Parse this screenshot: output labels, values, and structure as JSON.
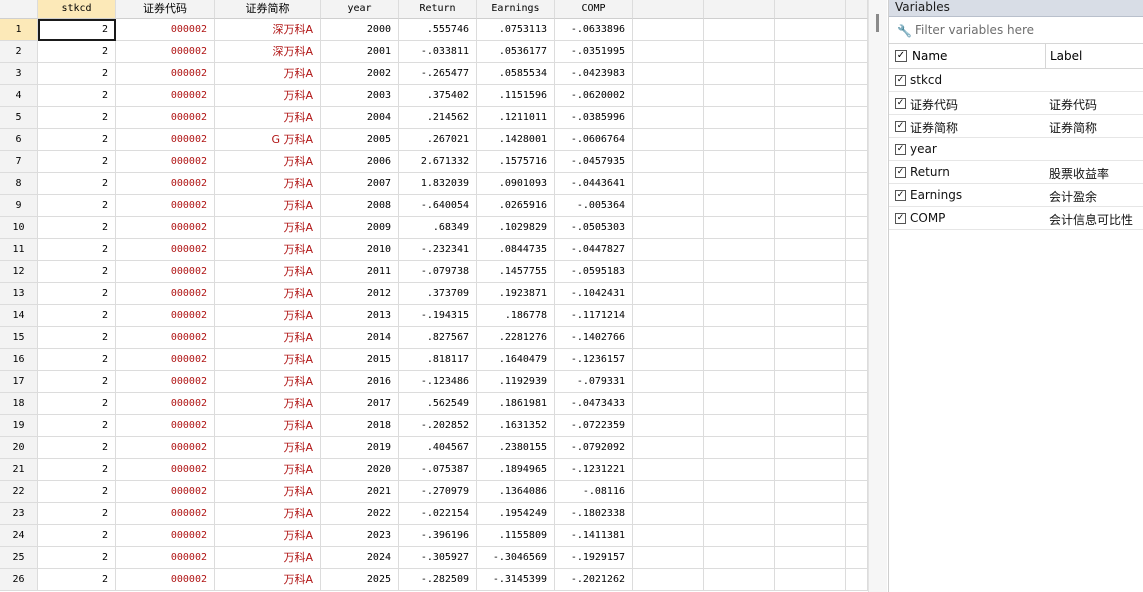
{
  "grid": {
    "headers": [
      "stkcd",
      "证券代码",
      "证券简称",
      "year",
      "Return",
      "Earnings",
      "COMP"
    ],
    "rows": [
      [
        "1",
        "2",
        "000002",
        "深万科A",
        "2000",
        ".555746",
        ".0753113",
        "-.0633896"
      ],
      [
        "2",
        "2",
        "000002",
        "深万科A",
        "2001",
        "-.033811",
        ".0536177",
        "-.0351995"
      ],
      [
        "3",
        "2",
        "000002",
        "万科A",
        "2002",
        "-.265477",
        ".0585534",
        "-.0423983"
      ],
      [
        "4",
        "2",
        "000002",
        "万科A",
        "2003",
        ".375402",
        ".1151596",
        "-.0620002"
      ],
      [
        "5",
        "2",
        "000002",
        "万科A",
        "2004",
        ".214562",
        ".1211011",
        "-.0385996"
      ],
      [
        "6",
        "2",
        "000002",
        "G 万科A",
        "2005",
        ".267021",
        ".1428001",
        "-.0606764"
      ],
      [
        "7",
        "2",
        "000002",
        "万科A",
        "2006",
        "2.671332",
        ".1575716",
        "-.0457935"
      ],
      [
        "8",
        "2",
        "000002",
        "万科A",
        "2007",
        "1.832039",
        ".0901093",
        "-.0443641"
      ],
      [
        "9",
        "2",
        "000002",
        "万科A",
        "2008",
        "-.640054",
        ".0265916",
        "-.005364"
      ],
      [
        "10",
        "2",
        "000002",
        "万科A",
        "2009",
        ".68349",
        ".1029829",
        "-.0505303"
      ],
      [
        "11",
        "2",
        "000002",
        "万科A",
        "2010",
        "-.232341",
        ".0844735",
        "-.0447827"
      ],
      [
        "12",
        "2",
        "000002",
        "万科A",
        "2011",
        "-.079738",
        ".1457755",
        "-.0595183"
      ],
      [
        "13",
        "2",
        "000002",
        "万科A",
        "2012",
        ".373709",
        ".1923871",
        "-.1042431"
      ],
      [
        "14",
        "2",
        "000002",
        "万科A",
        "2013",
        "-.194315",
        ".186778",
        "-.1171214"
      ],
      [
        "15",
        "2",
        "000002",
        "万科A",
        "2014",
        ".827567",
        ".2281276",
        "-.1402766"
      ],
      [
        "16",
        "2",
        "000002",
        "万科A",
        "2015",
        ".818117",
        ".1640479",
        "-.1236157"
      ],
      [
        "17",
        "2",
        "000002",
        "万科A",
        "2016",
        "-.123486",
        ".1192939",
        "-.079331"
      ],
      [
        "18",
        "2",
        "000002",
        "万科A",
        "2017",
        ".562549",
        ".1861981",
        "-.0473433"
      ],
      [
        "19",
        "2",
        "000002",
        "万科A",
        "2018",
        "-.202852",
        ".1631352",
        "-.0722359"
      ],
      [
        "20",
        "2",
        "000002",
        "万科A",
        "2019",
        ".404567",
        ".2380155",
        "-.0792092"
      ],
      [
        "21",
        "2",
        "000002",
        "万科A",
        "2020",
        "-.075387",
        ".1894965",
        "-.1231221"
      ],
      [
        "22",
        "2",
        "000002",
        "万科A",
        "2021",
        "-.270979",
        ".1364086",
        "-.08116"
      ],
      [
        "23",
        "2",
        "000002",
        "万科A",
        "2022",
        "-.022154",
        ".1954249",
        "-.1802338"
      ],
      [
        "24",
        "2",
        "000002",
        "万科A",
        "2023",
        "-.396196",
        ".1155809",
        "-.1411381"
      ],
      [
        "25",
        "2",
        "000002",
        "万科A",
        "2024",
        "-.305927",
        "-.3046569",
        "-.1929157"
      ],
      [
        "26",
        "2",
        "000002",
        "万科A",
        "2025",
        "-.282509",
        "-.3145399",
        "-.2021262"
      ]
    ]
  },
  "variables": {
    "title": "Variables",
    "filter_placeholder": "Filter variables here",
    "col_name": "Name",
    "col_label": "Label",
    "items": [
      {
        "name": "stkcd",
        "label": ""
      },
      {
        "name": "证券代码",
        "label": "证券代码"
      },
      {
        "name": "证券简称",
        "label": "证券简称"
      },
      {
        "name": "year",
        "label": ""
      },
      {
        "name": "Return",
        "label": "股票收益率"
      },
      {
        "name": "Earnings",
        "label": "会计盈余"
      },
      {
        "name": "COMP",
        "label": "会计信息可比性"
      }
    ]
  },
  "icons": {
    "checkbox": "checkbox-checked-icon",
    "filter": "wrench-icon"
  },
  "colors": {
    "string_text": "#b01414",
    "active_header": "#fce9b8",
    "pane_title_bg": "#d8dde6"
  }
}
